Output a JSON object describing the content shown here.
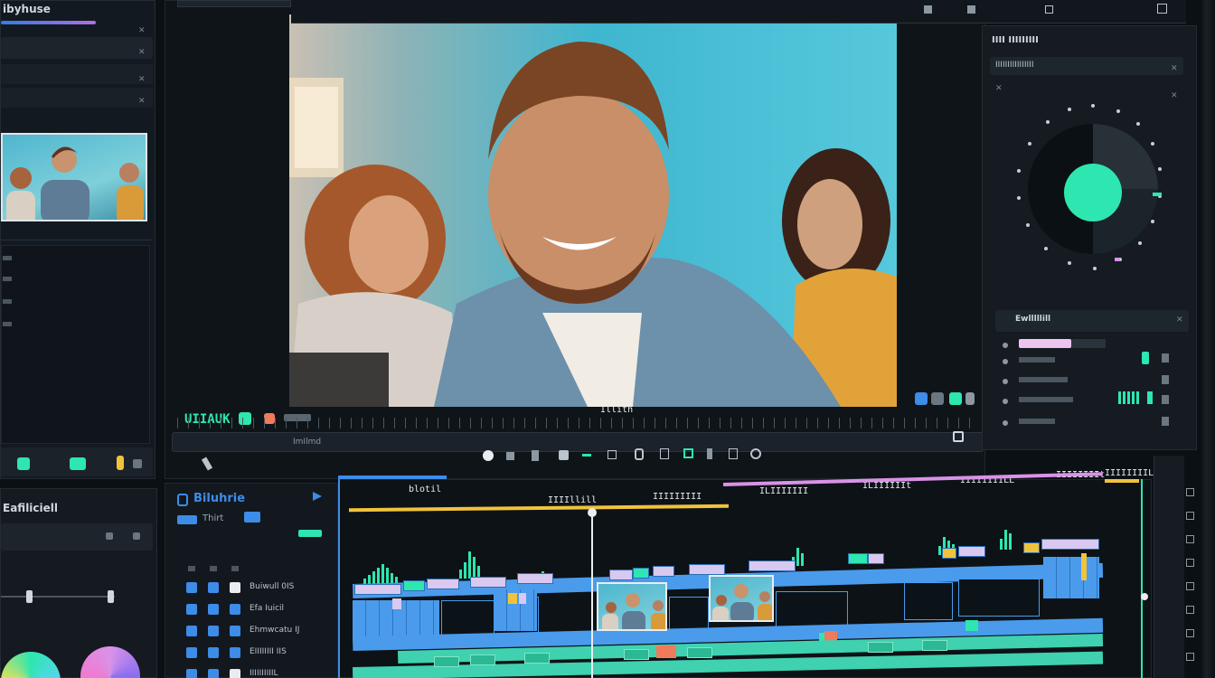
{
  "left_panel": {
    "title": "ibyhuse",
    "rows": [
      "",
      "",
      ""
    ],
    "thumb_caption": [
      "",
      ""
    ],
    "list": [
      "",
      "",
      "",
      "",
      ""
    ]
  },
  "left_bottom": {
    "title": "Eafiliciell",
    "row1": "",
    "row2": ""
  },
  "preview": {
    "timecode": "UIIAUK",
    "scrub_label": "ImIlmd",
    "center_label": "Illith"
  },
  "timeline_header": {
    "title": "Biluhrie",
    "subtitle": "Thirt",
    "markers": [
      "blotil",
      "IIIIllill",
      "IIIIIIIII",
      "ILIIIIIII",
      "ILIIIIIIt",
      "IIIIIIIILL",
      "IIIIIIIIt",
      "IIIIIIIIL"
    ],
    "track_labels": [
      "Buiwull 0IS",
      "Efa Iuicil",
      "Ehmwcatu IJ",
      "EIIIIIIII IIS",
      "IIIIIIIIIIL"
    ]
  },
  "right_panel": {
    "title": "IIII IIIIIIIII",
    "subtitle": "IIIIIIIIIIIIIIII",
    "section": "Ewlllllill",
    "rows": [
      "",
      "",
      "",
      ""
    ]
  },
  "colors": {
    "accent_teal": "#2ee6b0",
    "accent_blue": "#3d8ce8",
    "accent_pink": "#d992e8",
    "accent_yellow": "#f0c33c",
    "clip_blue": "#4a9bec",
    "clip_teal": "#3fd1b0"
  }
}
